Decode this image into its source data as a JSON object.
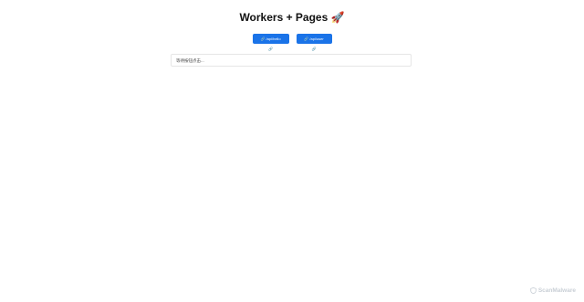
{
  "page": {
    "title": "Workers + Pages 🚀"
  },
  "buttons": {
    "hello_label": "🔗 /api/hello 🔗",
    "user_label": "🔗 /api/user 🔗"
  },
  "output": {
    "text": "等待按钮点击..."
  },
  "watermark": {
    "text": "ScanMalware",
    "icon": "shield-icon"
  },
  "colors": {
    "accent": "#1a73e8",
    "watermark": "#c9cfd6"
  }
}
